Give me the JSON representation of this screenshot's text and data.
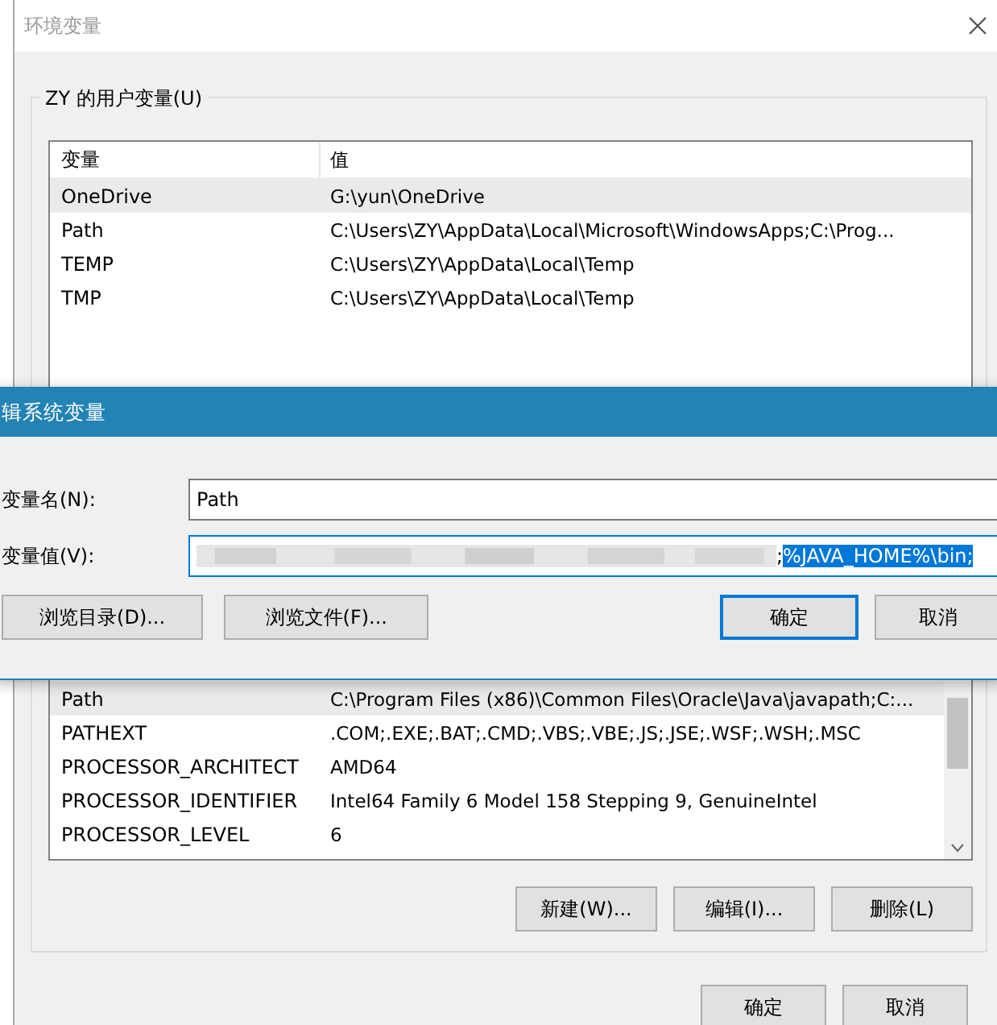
{
  "window": {
    "title": "环境变量"
  },
  "user_variables": {
    "label": "ZY 的用户变量(U)",
    "columns": [
      "变量",
      "值"
    ],
    "rows": [
      {
        "name": "OneDrive",
        "value": "G:\\yun\\OneDrive",
        "selected": true
      },
      {
        "name": "Path",
        "value": "C:\\Users\\ZY\\AppData\\Local\\Microsoft\\WindowsApps;C:\\Prog...",
        "selected": false
      },
      {
        "name": "TEMP",
        "value": "C:\\Users\\ZY\\AppData\\Local\\Temp",
        "selected": false
      },
      {
        "name": "TMP",
        "value": "C:\\Users\\ZY\\AppData\\Local\\Temp",
        "selected": false
      }
    ]
  },
  "system_variables": {
    "rows": [
      {
        "name": "Path",
        "value": "C:\\Program Files (x86)\\Common Files\\Oracle\\Java\\javapath;C:...",
        "selected": true
      },
      {
        "name": "PATHEXT",
        "value": ".COM;.EXE;.BAT;.CMD;.VBS;.VBE;.JS;.JSE;.WSF;.WSH;.MSC",
        "selected": false
      },
      {
        "name": "PROCESSOR_ARCHITECT",
        "value": "AMD64",
        "selected": false
      },
      {
        "name": "PROCESSOR_IDENTIFIER",
        "value": "Intel64 Family 6 Model 158 Stepping 9, GenuineIntel",
        "selected": false
      },
      {
        "name": "PROCESSOR_LEVEL",
        "value": "6",
        "selected": false
      }
    ],
    "buttons": [
      "新建(W)...",
      "编辑(I)...",
      "删除(L)"
    ]
  },
  "footer_buttons": [
    "确定",
    "取消"
  ],
  "edit_dialog": {
    "title": "辑系统变量",
    "name_label": "变量名(N):",
    "name_value": "Path",
    "value_label": "变量值(V):",
    "value_segments": [
      {
        "text": ";",
        "selected": false
      },
      {
        "text": "%JAVA_HOME%\\bin;",
        "selected": true
      }
    ],
    "buttons": [
      {
        "label": "浏览目录(D)...",
        "default": false
      },
      {
        "label": "浏览文件(F)...",
        "default": false
      },
      {
        "label": "确定",
        "default": true
      },
      {
        "label": "取消",
        "default": false
      }
    ]
  }
}
